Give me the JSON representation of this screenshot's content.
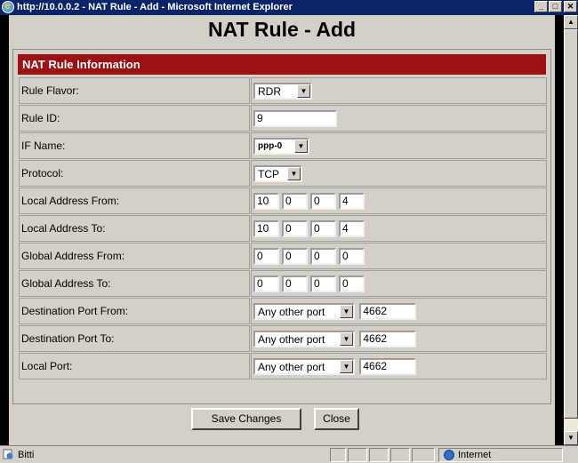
{
  "window": {
    "title": "http://10.0.0.2 - NAT Rule - Add - Microsoft Internet Explorer",
    "minimize": "_",
    "maximize": "□",
    "close": "✕"
  },
  "page": {
    "title": "NAT Rule - Add",
    "section_header": "NAT Rule Information"
  },
  "form": {
    "rule_flavor": {
      "label": "Rule Flavor:",
      "value": "RDR"
    },
    "rule_id": {
      "label": "Rule ID:",
      "value": "9"
    },
    "if_name": {
      "label": "IF Name:",
      "value": "ppp-0"
    },
    "protocol": {
      "label": "Protocol:",
      "value": "TCP"
    },
    "local_from": {
      "label": "Local Address From:",
      "octets": [
        "10",
        "0",
        "0",
        "4"
      ]
    },
    "local_to": {
      "label": "Local Address To:",
      "octets": [
        "10",
        "0",
        "0",
        "4"
      ]
    },
    "global_from": {
      "label": "Global Address From:",
      "octets": [
        "0",
        "0",
        "0",
        "0"
      ]
    },
    "global_to": {
      "label": "Global Address To:",
      "octets": [
        "0",
        "0",
        "0",
        "0"
      ]
    },
    "dest_port_from": {
      "label": "Destination Port From:",
      "select": "Any other port",
      "value": "4662"
    },
    "dest_port_to": {
      "label": "Destination Port To:",
      "select": "Any other port",
      "value": "4662"
    },
    "local_port": {
      "label": "Local Port:",
      "select": "Any other port",
      "value": "4662"
    }
  },
  "buttons": {
    "save": "Save Changes",
    "close": "Close"
  },
  "statusbar": {
    "status": "Bitti",
    "zone": "Internet"
  },
  "icons": {
    "browser": "ie-icon",
    "zone": "internet-zone-icon"
  }
}
